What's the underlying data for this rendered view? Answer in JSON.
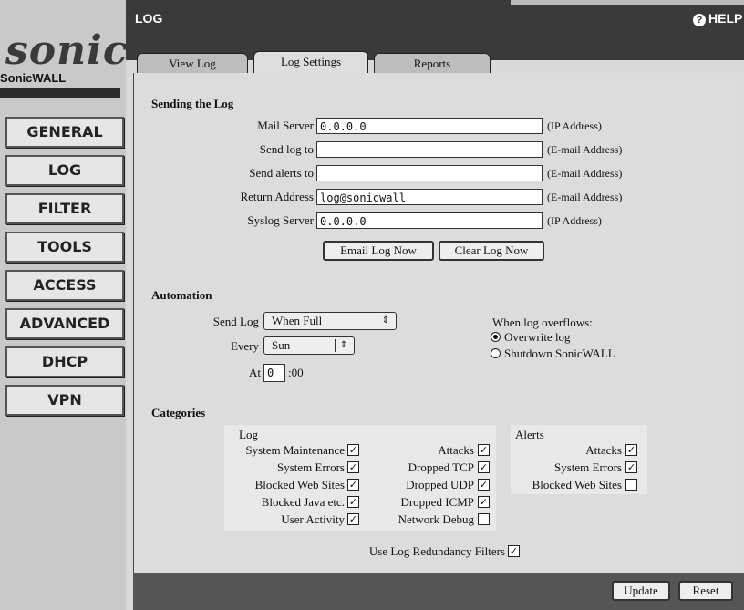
{
  "header": {
    "title": "LOG",
    "help_label": "HELP"
  },
  "brand": {
    "logo_text": "sonic",
    "name": "SonicWALL"
  },
  "sidebar": {
    "items": [
      {
        "label": "GENERAL"
      },
      {
        "label": "LOG"
      },
      {
        "label": "FILTER"
      },
      {
        "label": "TOOLS"
      },
      {
        "label": "ACCESS"
      },
      {
        "label": "ADVANCED"
      },
      {
        "label": "DHCP"
      },
      {
        "label": "VPN"
      }
    ]
  },
  "tabs": [
    {
      "label": "View Log"
    },
    {
      "label": "Log Settings",
      "active": true
    },
    {
      "label": "Reports"
    }
  ],
  "sending": {
    "title": "Sending the Log",
    "mail_server": {
      "label": "Mail Server",
      "value": "0.0.0.0",
      "hint": "(IP Address)"
    },
    "send_log_to": {
      "label": "Send log to",
      "value": "",
      "hint": "(E-mail Address)"
    },
    "send_alerts_to": {
      "label": "Send alerts to",
      "value": "",
      "hint": "(E-mail Address)"
    },
    "return_address": {
      "label": "Return Address",
      "value": "log@sonicwall",
      "hint": "(E-mail Address)"
    },
    "syslog_server": {
      "label": "Syslog Server",
      "value": "0.0.0.0",
      "hint": "(IP Address)"
    },
    "email_log_now": "Email Log Now",
    "clear_log_now": "Clear Log Now"
  },
  "automation": {
    "title": "Automation",
    "send_log_label": "Send Log",
    "send_log_value": "When Full",
    "every_label": "Every",
    "every_value": "Sun",
    "at_label": "At",
    "at_value": "0",
    "at_suffix": ":00",
    "overflow_label": "When log overflows:",
    "overwrite_label": "Overwrite log",
    "shutdown_label": "Shutdown SonicWALL",
    "overwrite_selected": true
  },
  "categories": {
    "title": "Categories",
    "log_header": "Log",
    "alerts_header": "Alerts",
    "log_col1": [
      {
        "label": "System Maintenance",
        "checked": true
      },
      {
        "label": "System Errors",
        "checked": true
      },
      {
        "label": "Blocked Web Sites",
        "checked": true
      },
      {
        "label": "Blocked Java etc.",
        "checked": true
      },
      {
        "label": "User Activity",
        "checked": true
      }
    ],
    "log_col2": [
      {
        "label": "Attacks",
        "checked": true
      },
      {
        "label": "Dropped TCP",
        "checked": true
      },
      {
        "label": "Dropped UDP",
        "checked": true
      },
      {
        "label": "Dropped ICMP",
        "checked": true
      },
      {
        "label": "Network Debug",
        "checked": false
      }
    ],
    "alerts": [
      {
        "label": "Attacks",
        "checked": true
      },
      {
        "label": "System Errors",
        "checked": true
      },
      {
        "label": "Blocked Web Sites",
        "checked": false
      }
    ],
    "redundancy_label": "Use Log Redundancy Filters",
    "redundancy_checked": true
  },
  "footer": {
    "update_label": "Update",
    "reset_label": "Reset"
  }
}
